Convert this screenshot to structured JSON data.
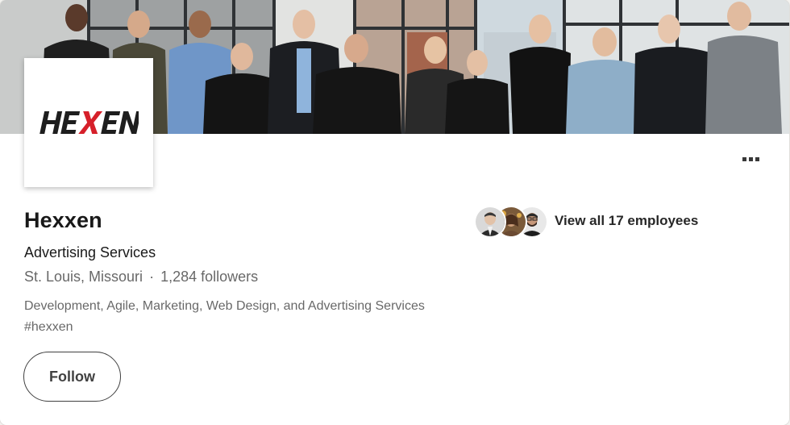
{
  "banner": {
    "image": "team-photo"
  },
  "logo": {
    "wordmark": "HEXEN"
  },
  "company": {
    "name": "Hexxen",
    "industry": "Advertising Services",
    "location": "St. Louis, Missouri",
    "separator": "·",
    "followers": "1,284 followers",
    "tagline": "Development, Agile, Marketing, Web Design, and Advertising Services #hexxen"
  },
  "actions": {
    "follow_label": "Follow",
    "more_icon": "ellipsis-icon"
  },
  "employees": {
    "label": "View all 17 employees",
    "avatars": [
      "employee-avatar-1",
      "employee-avatar-2",
      "employee-avatar-3"
    ]
  },
  "colors": {
    "logo_accent": "#d6202a",
    "logo_dark": "#1e1e1e"
  }
}
